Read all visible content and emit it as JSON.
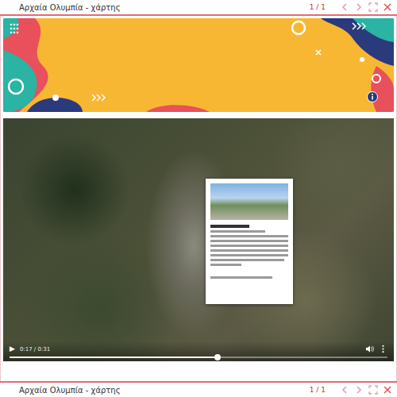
{
  "window": {
    "title": "Αρχαία Ολυμπία - χάρτης",
    "counter": "1 / 1"
  },
  "video": {
    "play": "▶",
    "time": "0:17 / 0:31",
    "level": 0.55
  },
  "next_slide": {
    "title": "Αρχαία Ολυμπία - χάρτης",
    "counter": "1 / 1"
  }
}
